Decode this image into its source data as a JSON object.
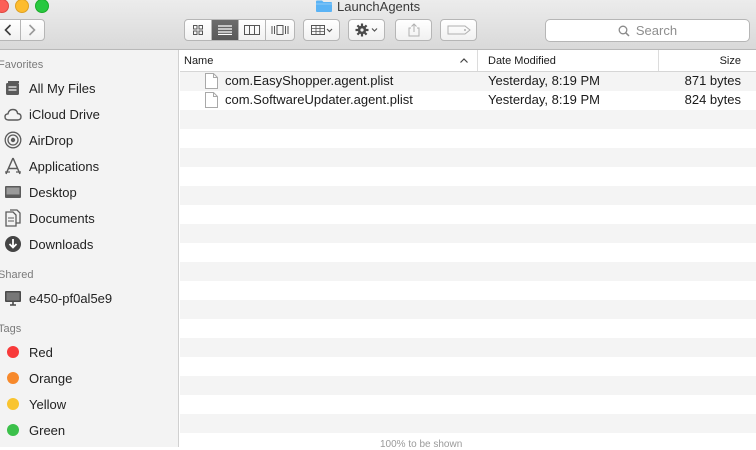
{
  "window": {
    "title": "LaunchAgents",
    "status_text": "100% to be shown"
  },
  "toolbar": {
    "back_icon": "chevron-left-icon",
    "forward_icon": "chevron-right-icon",
    "view_modes": [
      "icon-view",
      "list-view",
      "column-view",
      "cover-flow-view"
    ],
    "active_view": "list-view",
    "arrange_icon": "arrange-grid-icon",
    "action_icon": "gear-icon",
    "share_icon": "share-icon",
    "tags_icon": "tag-icon",
    "search_placeholder": "Search"
  },
  "sidebar": {
    "favorites_label": "Favorites",
    "favorites": [
      {
        "label": "All My Files",
        "icon": "all-files-icon"
      },
      {
        "label": "iCloud Drive",
        "icon": "cloud-icon"
      },
      {
        "label": "AirDrop",
        "icon": "airdrop-icon"
      },
      {
        "label": "Applications",
        "icon": "applications-icon"
      },
      {
        "label": "Desktop",
        "icon": "desktop-icon"
      },
      {
        "label": "Documents",
        "icon": "documents-icon"
      },
      {
        "label": "Downloads",
        "icon": "downloads-icon"
      }
    ],
    "shared_label": "Shared",
    "shared": [
      {
        "label": "e450-pf0al5e9",
        "icon": "monitor-icon"
      }
    ],
    "tags_label": "Tags",
    "tags": [
      {
        "label": "Red",
        "color": "#f83a3a"
      },
      {
        "label": "Orange",
        "color": "#f7892b"
      },
      {
        "label": "Yellow",
        "color": "#f9c42f"
      },
      {
        "label": "Green",
        "color": "#3bc04a"
      }
    ]
  },
  "columns": {
    "name": "Name",
    "date": "Date Modified",
    "size": "Size"
  },
  "files": [
    {
      "name": "com.EasyShopper.agent.plist",
      "date": "Yesterday, 8:19 PM",
      "size": "871 bytes"
    },
    {
      "name": "com.SoftwareUpdater.agent.plist",
      "date": "Yesterday, 8:19 PM",
      "size": "824 bytes"
    }
  ],
  "colors": {
    "accent": "#5ab3f5",
    "active_segment": "#5f5f5f"
  }
}
